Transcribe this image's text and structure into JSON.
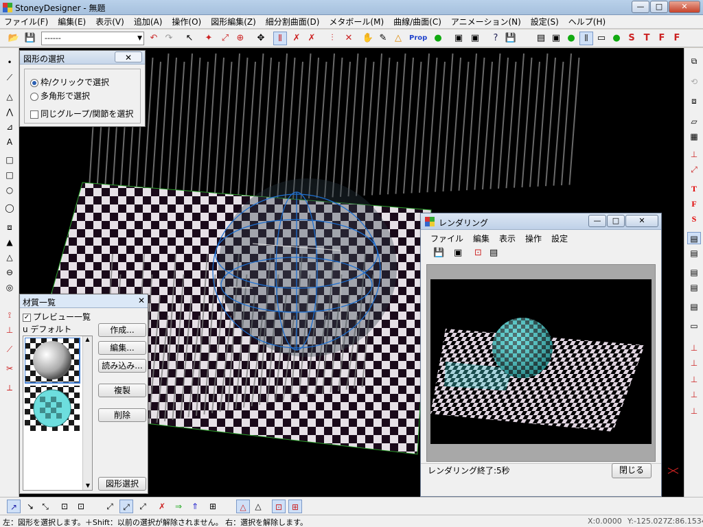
{
  "window": {
    "title": "StoneyDesigner - 無題",
    "min": "—",
    "max": "□",
    "close": "✕"
  },
  "menu": [
    "ファイル(F)",
    "編集(E)",
    "表示(V)",
    "追加(A)",
    "操作(O)",
    "図形編集(Z)",
    "細分割曲面(D)",
    "メタボール(M)",
    "曲線/曲面(C)",
    "アニメーション(N)",
    "設定(S)",
    "ヘルプ(H)"
  ],
  "toolbar": {
    "layer_value": "------",
    "prop_label": "Prop",
    "text_tools": [
      "S",
      "T",
      "F"
    ]
  },
  "right_text_tools": [
    "T",
    "F",
    "S"
  ],
  "left_text_tools": [
    "A"
  ],
  "selection_panel": {
    "title": "図形の選択",
    "close": "✕",
    "options": [
      "枠/クリックで選択",
      "多角形で選択"
    ],
    "selected_option": 0,
    "group_check": "同じグループ/関節を選択",
    "group_checked": false
  },
  "material_panel": {
    "title": "材質一覧",
    "close": "✕",
    "preview_check": "プレビュー一覧",
    "preview_checked": true,
    "current_material": "u デフォルト",
    "buttons": [
      "作成...",
      "編集...",
      "読み込み...",
      "複製",
      "削除",
      "図形選択"
    ]
  },
  "render_window": {
    "title": "レンダリング",
    "menu": [
      "ファイル",
      "編集",
      "表示",
      "操作",
      "設定"
    ],
    "status": "レンダリング終了:5秒",
    "close_button": "閉じる"
  },
  "statusbar": {
    "message": "左：図形を選択します。＋Shift：以前の選択が解除されません。 右：選択を解除します。",
    "x": "X:0.0000",
    "y": "Y:-125.027",
    "z": "Z:86.1534"
  },
  "colors": {
    "sphere_teal": "#44d6d6",
    "wire_blue": "#1e6fd0",
    "checker_light": "#e6e0e6",
    "checker_dark": "#1a0a1a",
    "accent_red": "#e00000"
  }
}
